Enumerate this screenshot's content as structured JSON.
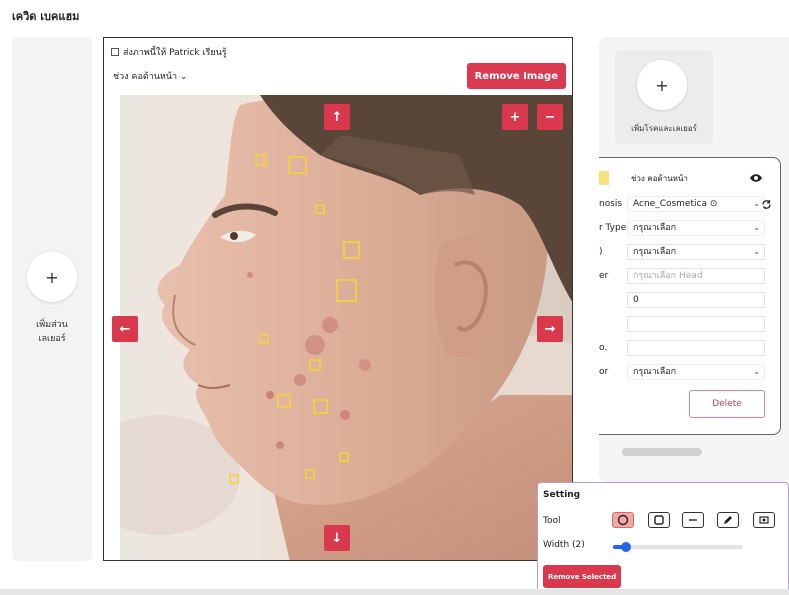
{
  "page": {
    "title": "เควิด เบคแฮม"
  },
  "left_panel": {
    "add_label": "เพิ่มส่วน\nเลเยอร์"
  },
  "image_card": {
    "send_checkbox_label": "ส่งภาพนี้ให้ Patrick เรียนรู้",
    "region_label": "ช่วง คอด้านหน้า",
    "remove_image_label": "Remove Image"
  },
  "right_panel": {
    "add_disease_label": "เพิ่มโรคและเลเยอร์",
    "detail": {
      "region_label": "ช่วง คอด้านหน้า",
      "swatch_color": "#f4e27a",
      "rows": [
        {
          "label": "nosis",
          "value": "Acne_Cosmetica ⊙",
          "kind": "select"
        },
        {
          "label": "r Type",
          "value": "กรุณาเลือก",
          "kind": "select"
        },
        {
          "label": ")",
          "value": "กรุณาเลือก",
          "kind": "select"
        },
        {
          "label": "er",
          "value": "กรุณาเลือก Head",
          "kind": "placeholder"
        },
        {
          "label": "",
          "value": "0",
          "kind": "text"
        },
        {
          "label": "",
          "value": "",
          "kind": "text"
        },
        {
          "label": "o.",
          "value": "",
          "kind": "text"
        },
        {
          "label": "or",
          "value": "กรุณาเลือก",
          "kind": "select"
        }
      ],
      "delete_label": "Delete"
    }
  },
  "settings": {
    "title": "Setting",
    "tool_label": "Tool",
    "tools": [
      "circle-tool",
      "square-tool",
      "line-tool",
      "pen-tool",
      "image-tool"
    ],
    "active_tool": "circle-tool",
    "width_label": "Width (2)",
    "width_value": 2,
    "width_max": 20,
    "remove_selected_label": "Remove Selected"
  },
  "colors": {
    "accent": "#d9384d",
    "marker": "#f5d33a",
    "slider": "#2563eb"
  }
}
